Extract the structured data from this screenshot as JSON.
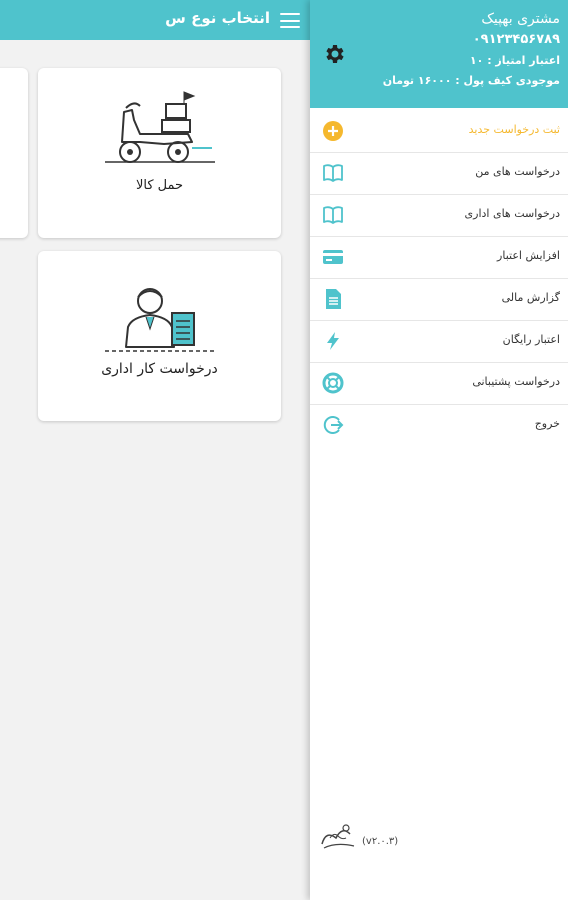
{
  "appbar": {
    "title": "انتخاب نوع س"
  },
  "cards": [
    {
      "label": "حمل کالا",
      "icon": "scooter-icon"
    },
    {
      "label": "درخواست کار اداری",
      "icon": "office-worker-icon"
    }
  ],
  "drawer": {
    "name": "مشتری بهپیک",
    "phone": "۰۹۱۲۳۴۵۶۷۸۹",
    "points": "اعتبار امتیاز : ۱۰",
    "wallet": "موجودی کیف پول : ۱۶۰۰۰ تومان",
    "items": [
      {
        "label": "ثبت درخواست جدید",
        "icon": "plus-circle-icon"
      },
      {
        "label": "درخواست های من",
        "icon": "book-icon"
      },
      {
        "label": "درخواست های اداری",
        "icon": "book-icon"
      },
      {
        "label": "افزایش اعتبار",
        "icon": "credit-card-icon"
      },
      {
        "label": "گزارش مالی",
        "icon": "report-icon"
      },
      {
        "label": "اعتبار رایگان",
        "icon": "lightning-icon"
      },
      {
        "label": "درخواست پشتیبانی",
        "icon": "lifebuoy-icon"
      },
      {
        "label": "خروج",
        "icon": "exit-icon"
      }
    ],
    "version": "(v۲.۰.۳)"
  },
  "colors": {
    "accent": "#4fc3cc",
    "highlight": "#f5b82e",
    "text": "#333333"
  }
}
